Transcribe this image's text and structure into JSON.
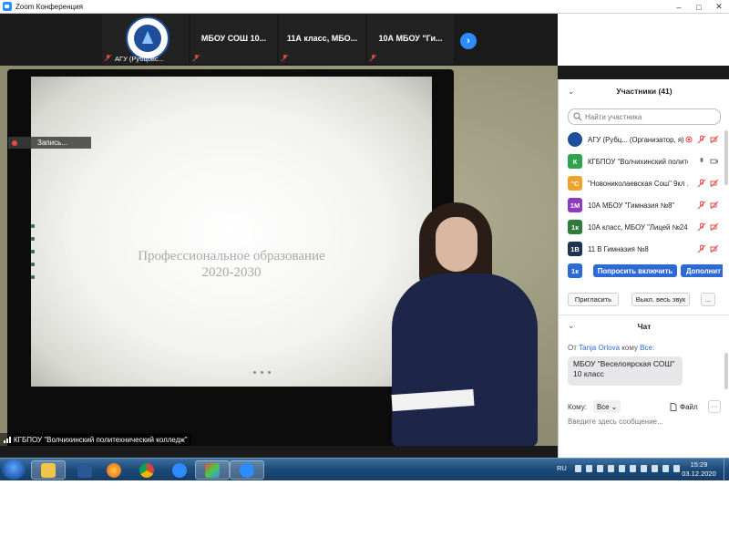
{
  "window": {
    "title": "Zoom Конференция"
  },
  "gallery": {
    "tiles": [
      {
        "label": "АГУ (Рубцовс...",
        "name": ""
      },
      {
        "label": "",
        "name": "МБОУ СОШ 10..."
      },
      {
        "label": "",
        "name": "11А класс, МБО..."
      },
      {
        "label": "",
        "name": "10А МБОУ \"Ги..."
      }
    ],
    "next_icon": "›"
  },
  "main_video": {
    "recording_label": "Запись...",
    "slide_title_line1": "Профессиональное образование",
    "slide_title_line2": "2020-2030",
    "speaker_label": "КГБПОУ \"Волчихинский политехнический колледж\""
  },
  "participants": {
    "title": "Участники (41)",
    "search_placeholder": "Найти участника",
    "list": [
      {
        "initials": "",
        "color": "#1d4f9c",
        "name": "АГУ (Рубц... (Организатор, я)"
      },
      {
        "initials": "К",
        "color": "#2ea44f",
        "name": "КГБПОУ \"Волчихинский полите..."
      },
      {
        "initials": "\"С",
        "color": "#f0a22e",
        "name": "\"Новониколаевская Сош\" 9кл ..."
      },
      {
        "initials": "1М",
        "color": "#8e3bbd",
        "name": "10А  МБОУ \"Гимназия №8\""
      },
      {
        "initials": "1к",
        "color": "#2f7a3d",
        "name": "10А класс, МБОУ \"Лицей №24\"..."
      },
      {
        "initials": "1В",
        "color": "#1f3354",
        "name": "11 В Гимназия №8"
      },
      {
        "initials": "1к",
        "color": "#2d6ad3",
        "name": ""
      }
    ],
    "ask_unmute_label": "Попросить включить",
    "more_label": "Дополнит",
    "invite_label": "Пригласить",
    "mute_all_label": "Выкл. весь звук",
    "more_dots": "..."
  },
  "chat": {
    "title": "Чат",
    "from_prefix": "От",
    "from_name": "Tanja Orlova",
    "to_word": "кому",
    "to_target": "Все:",
    "message": "МБОУ \"Веселоярская СОШ\" 10 класс",
    "to_label": "Кому:",
    "to_select": "Все",
    "file_label": "Файл",
    "input_placeholder": "Введите здесь сообщение..."
  },
  "taskbar": {
    "lang": "RU",
    "time": "15:29",
    "date": "03.12.2020"
  }
}
